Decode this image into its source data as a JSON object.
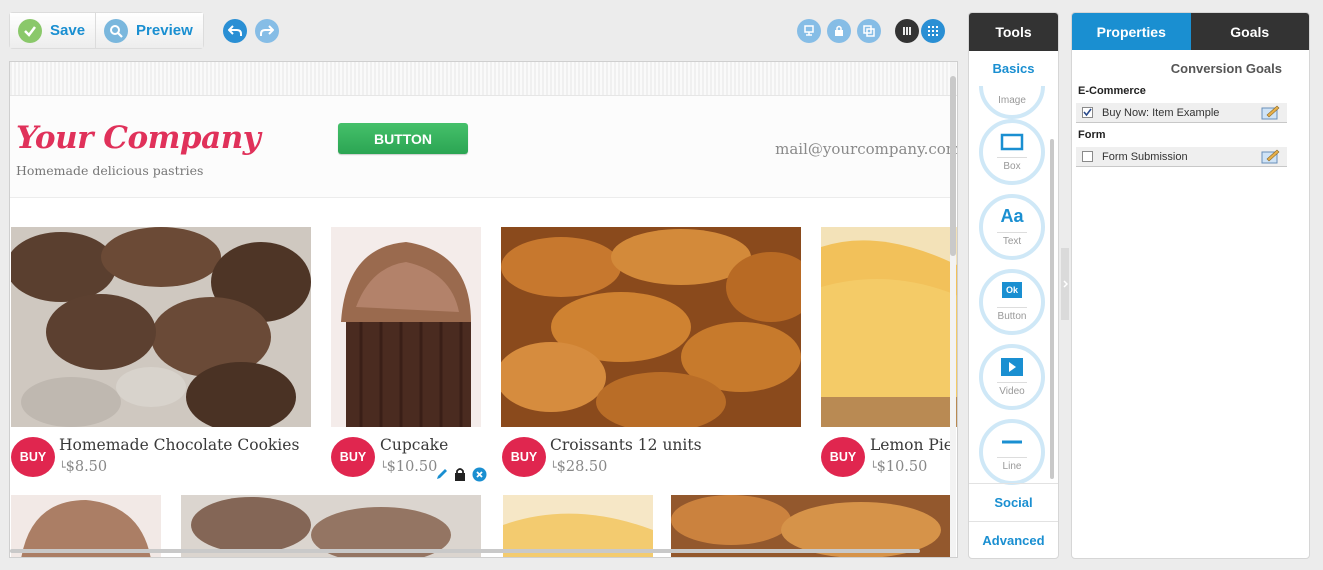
{
  "toolbar": {
    "save_label": "Save",
    "preview_label": "Preview"
  },
  "canvas": {
    "header": {
      "logo_text": "Your Company",
      "tagline": "Homemade delicious pastries",
      "button_label": "BUTTON",
      "email": "mail@yourcompany.com"
    },
    "products": [
      {
        "name": "Homemade Chocolate Cookies",
        "price": "$8.50",
        "buy_label": "BUY",
        "image": "chocolate-cookies"
      },
      {
        "name": "Cupcake",
        "price": "$10.50",
        "buy_label": "BUY",
        "image": "cupcake"
      },
      {
        "name": "Croissants 12 units",
        "price": "$28.50",
        "buy_label": "BUY",
        "image": "croissants"
      },
      {
        "name": "Lemon Pie",
        "price": "$10.50",
        "buy_label": "BUY",
        "image": "lemon-pie"
      }
    ],
    "selected_controls": [
      "pencil-icon",
      "lock-icon",
      "close-icon"
    ]
  },
  "tools": {
    "title": "Tools",
    "sections": {
      "basics": "Basics",
      "social": "Social",
      "advanced": "Advanced"
    },
    "items": [
      {
        "label": "Image",
        "icon": "image-icon"
      },
      {
        "label": "Box",
        "icon": "box-icon"
      },
      {
        "label": "Text",
        "icon": "text-icon",
        "glyph": "Aa"
      },
      {
        "label": "Button",
        "icon": "button-icon",
        "glyph": "Ok"
      },
      {
        "label": "Video",
        "icon": "video-icon"
      },
      {
        "label": "Line",
        "icon": "line-icon"
      }
    ]
  },
  "properties": {
    "tabs": {
      "properties": "Properties",
      "goals": "Goals"
    },
    "section_title": "Conversion Goals",
    "groups": [
      {
        "name": "E-Commerce",
        "goals": [
          {
            "label": "Buy Now: Item Example",
            "checked": true
          }
        ]
      },
      {
        "name": "Form",
        "goals": [
          {
            "label": "Form Submission",
            "checked": false
          }
        ]
      }
    ]
  },
  "colors": {
    "accent_blue": "#1a8fd1",
    "brand_red": "#e0315a",
    "buy_red": "#e0264f",
    "button_green": "#2ba553",
    "dark_header": "#333333"
  }
}
